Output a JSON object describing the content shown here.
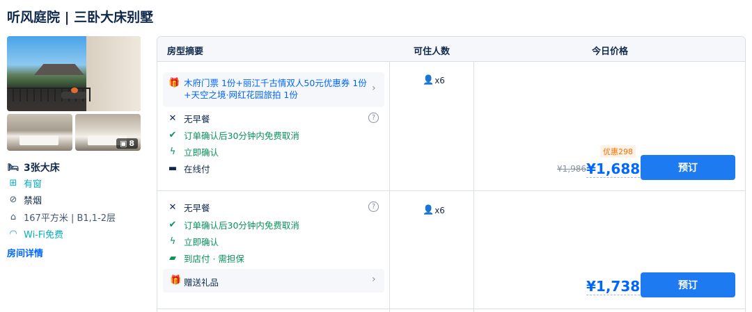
{
  "title": "听风庭院 | 三卧大床别墅",
  "gallery": {
    "count": "8"
  },
  "room_features": {
    "bed": "3张大床",
    "window": "有窗",
    "smoking": "禁烟",
    "area": "167平方米 | B1,1-2层",
    "wifi": "Wi-Fi免费",
    "detail_link": "房间详情"
  },
  "table": {
    "headers": {
      "summary": "房型摘要",
      "guests": "可住人数",
      "price": "今日价格"
    }
  },
  "rates": [
    {
      "promo": "木府门票 1份+丽江千古情双人50元优惠券 1份+天空之境·网红花园旅拍 1份",
      "meal": "无早餐",
      "cancel": "订单确认后30分钟内免费取消",
      "confirm": "立即确认",
      "payment": "在线付",
      "guests": "x6",
      "discount": "优惠298",
      "original_price": "¥1,986",
      "price": "¥1,688",
      "book": "预订"
    },
    {
      "meal": "无早餐",
      "cancel": "订单确认后30分钟内免费取消",
      "confirm": "立即确认",
      "payment": "到店付 · 需担保",
      "gift": "赠送礼品",
      "guests": "x6",
      "price": "¥1,738",
      "book": "预订"
    }
  ],
  "colors": {
    "accent": "#0066ff",
    "book_button": "#1e7af0",
    "green": "#08925a",
    "teal": "#06aebd",
    "discount": "#ff6f00"
  },
  "icons": [
    "gallery-icon",
    "bed-icon",
    "window-icon",
    "no-smoking-icon",
    "area-icon",
    "wifi-icon",
    "gift-icon",
    "no-breakfast-icon",
    "check-circle-icon",
    "lightning-icon",
    "card-icon",
    "pay-at-hotel-icon",
    "help-icon",
    "chevron-right-icon",
    "person-icon"
  ]
}
